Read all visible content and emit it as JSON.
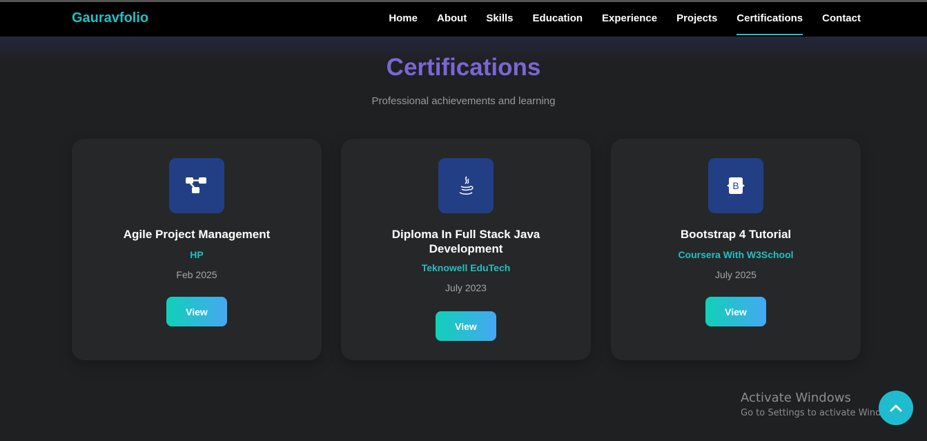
{
  "nav": {
    "brand": "Gauravfolio",
    "links": [
      "Home",
      "About",
      "Skills",
      "Education",
      "Experience",
      "Projects",
      "Certifications",
      "Contact"
    ],
    "active": "Certifications"
  },
  "section": {
    "title": "Certifications",
    "subtitle": "Professional achievements and learning"
  },
  "cards": [
    {
      "icon": "project-diagram-icon",
      "title": "Agile Project Management",
      "issuer": "HP",
      "date": "Feb 2025",
      "button": "View"
    },
    {
      "icon": "java-icon",
      "title": "Diploma In Full Stack Java Development",
      "issuer": "Teknowell EduTech",
      "date": "July 2023",
      "button": "View"
    },
    {
      "icon": "bootstrap-icon",
      "title": "Bootstrap 4 Tutorial",
      "issuer": "Coursera With W3School",
      "date": "July 2025",
      "button": "View"
    }
  ],
  "bootstrap_icon_letter": "B",
  "watermark": {
    "title": "Activate Windows",
    "subtitle": "Go to Settings to activate Windows."
  },
  "scroll_top": {
    "icon": "chevron-up-icon"
  },
  "colors": {
    "accent": "#22c1c3",
    "title": "#7b66d6",
    "icon_bg": "#223f86",
    "button_gradient_start": "#10d0b8",
    "button_gradient_end": "#45a8f2"
  }
}
